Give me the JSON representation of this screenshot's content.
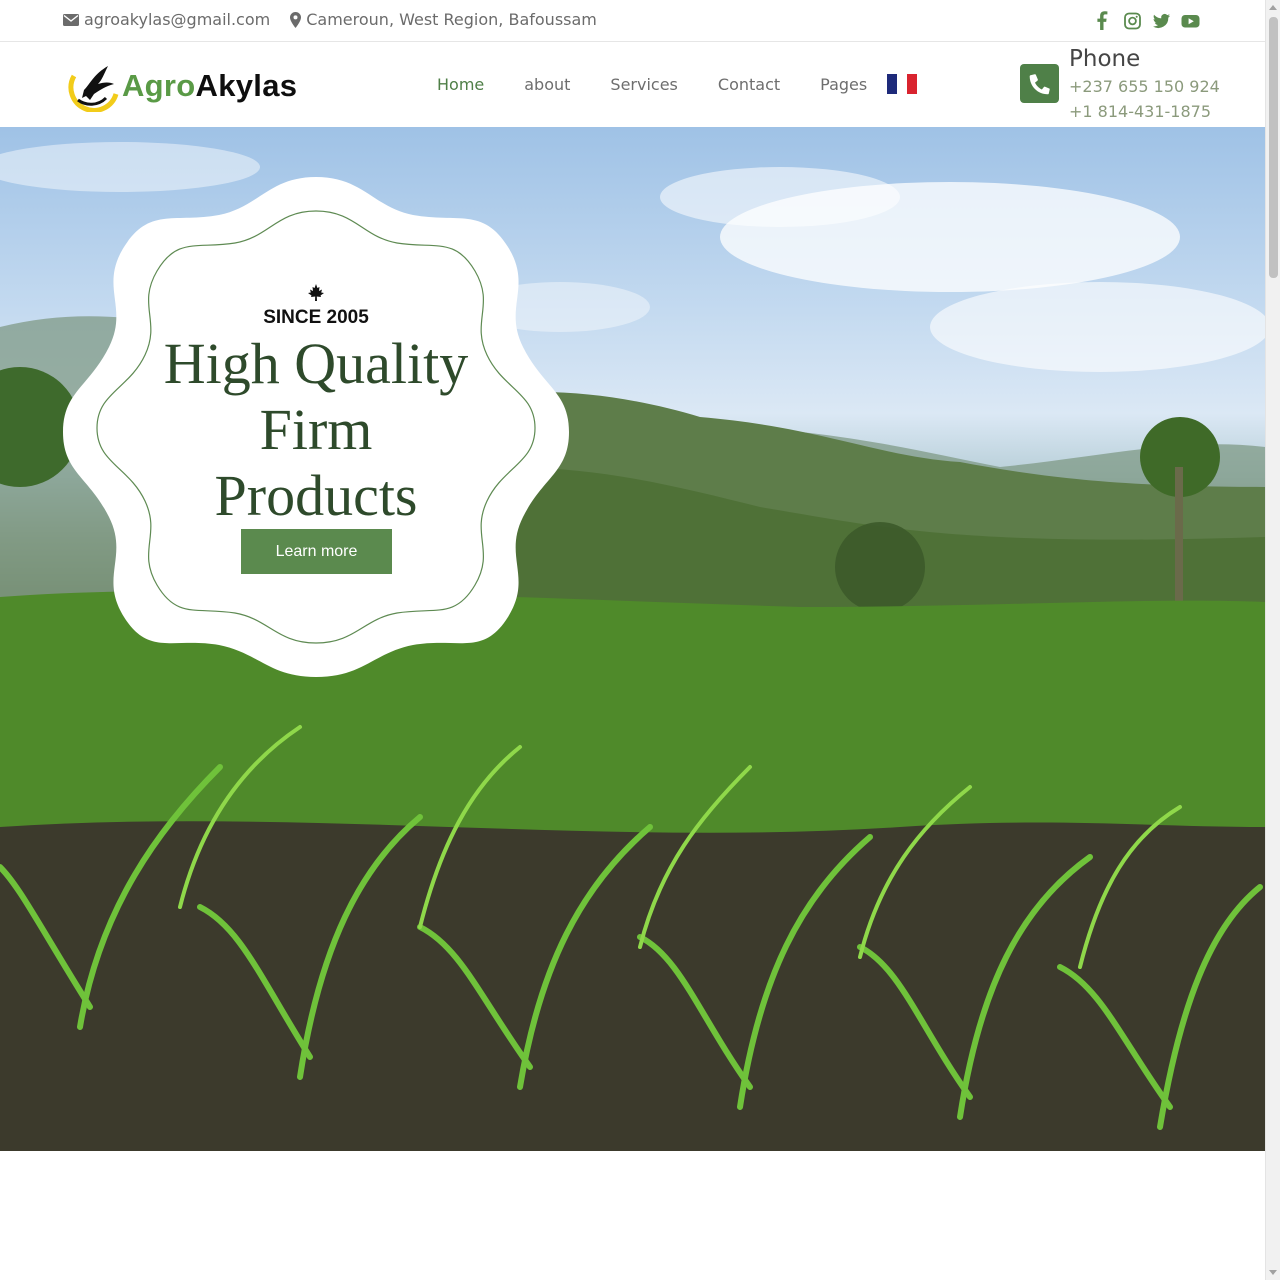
{
  "topbar": {
    "email": "agroakylas@gmail.com",
    "address": "Cameroun, West Region, Bafoussam",
    "social_icons": [
      "facebook-icon",
      "instagram-icon",
      "twitter-icon",
      "youtube-icon"
    ]
  },
  "navbar": {
    "brand_part1": "Agro",
    "brand_part2": "Akylas",
    "menu": [
      {
        "label": "Home",
        "active": true
      },
      {
        "label": "about",
        "active": false
      },
      {
        "label": "Services",
        "active": false
      },
      {
        "label": "Contact",
        "active": false
      },
      {
        "label": "Pages",
        "active": false
      }
    ],
    "language_flag": "flag-fr-icon",
    "phone_title": "Phone",
    "phone_numbers": [
      "+237 655 150 924",
      "+1 814-431-1875"
    ]
  },
  "hero": {
    "since": "SINCE 2005",
    "title_lines": [
      "High Quality",
      "Firm",
      "Products"
    ],
    "button_label": "Learn more"
  },
  "colors": {
    "accent_green": "#5b8a4e",
    "brand_green": "#5a9a46",
    "title_green": "#2e4a2b"
  }
}
